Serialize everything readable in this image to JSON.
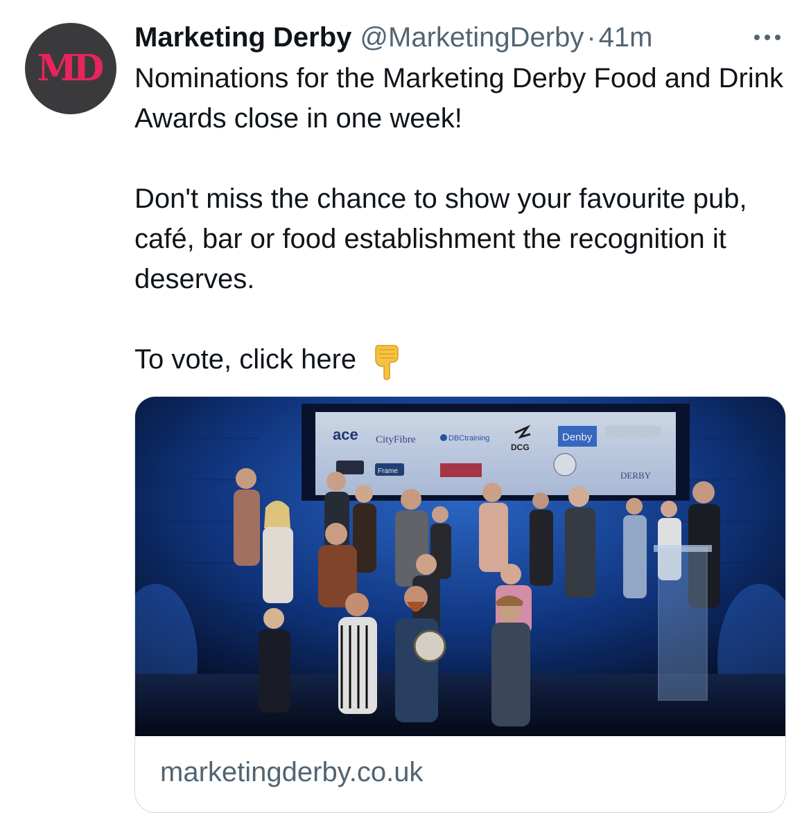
{
  "tweet": {
    "author": {
      "display_name": "Marketing Derby",
      "handle": "@MarketingDerby",
      "avatar_logo": "MD",
      "avatar_color": "#3a3a3c",
      "logo_color": "#e8245c"
    },
    "separator": "·",
    "timestamp": "41m",
    "more_icon": "more-horizontal-icon",
    "paragraphs": [
      "Nominations for the Marketing Derby Food and Drink Awards close in one week!",
      "Don't miss the chance to show your favourite pub, café, bar or food establishment the recognition it deserves.",
      "To vote, click here"
    ],
    "emoji": "backhand-index-pointing-down-icon"
  },
  "link_card": {
    "domain": "marketingderby.co.uk",
    "sponsor_logos": {
      "ace": "ace",
      "cityfibre": "CityFibre",
      "dbc": "DBCtraining",
      "dcg": "DCG",
      "denby": "Denby",
      "frame": "Frame",
      "derby": "DERBY"
    }
  }
}
